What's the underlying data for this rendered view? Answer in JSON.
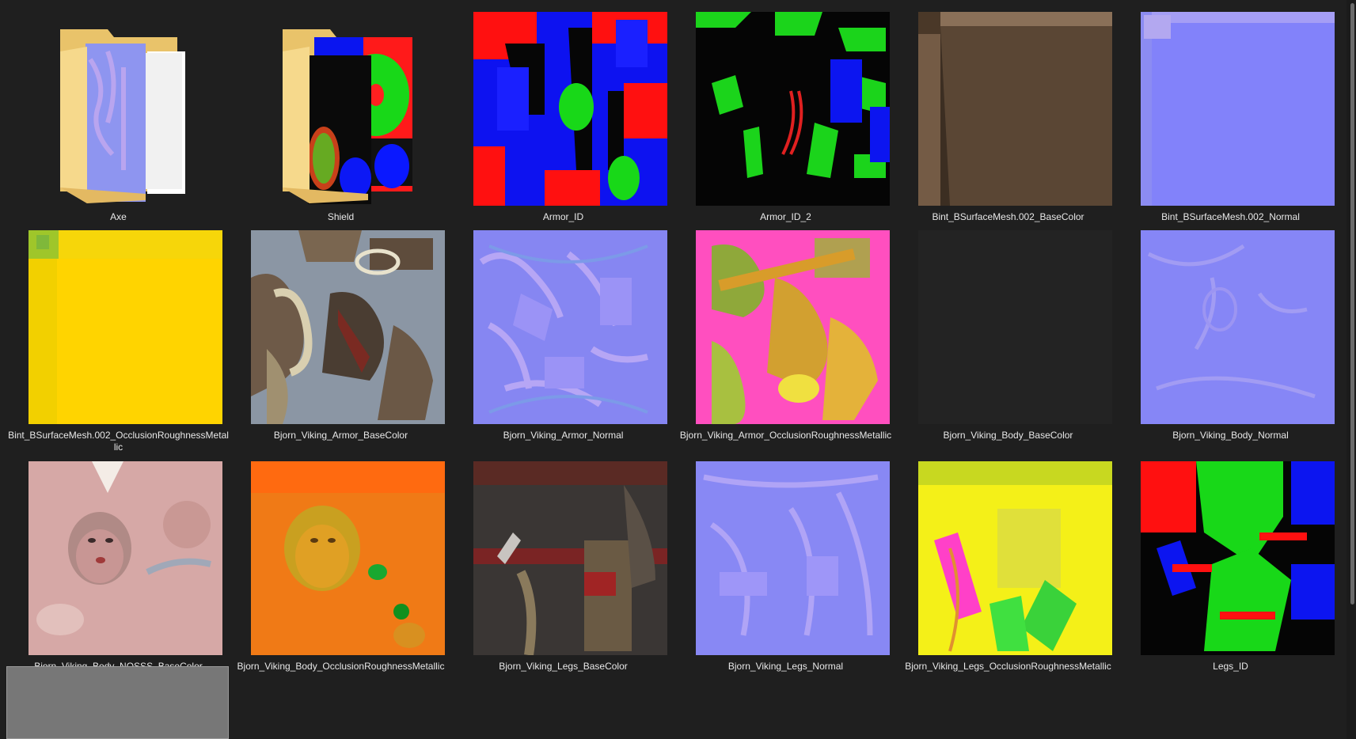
{
  "files": [
    {
      "name": "Axe",
      "kind": "folder-icon"
    },
    {
      "name": "Shield",
      "kind": "folder-icon"
    },
    {
      "name": "Armor_ID",
      "kind": "id-map-thumbnail"
    },
    {
      "name": "Armor_ID_2",
      "kind": "id-map-thumbnail"
    },
    {
      "name": "Bint_BSurfaceMesh.002_BaseColor",
      "kind": "basecolor-thumbnail"
    },
    {
      "name": "Bint_BSurfaceMesh.002_Normal",
      "kind": "normal-map-thumbnail"
    },
    {
      "name": "Bint_BSurfaceMesh.002_OcclusionRoughnessMetallic",
      "kind": "orm-map-thumbnail"
    },
    {
      "name": "Bjorn_Viking_Armor_BaseColor",
      "kind": "basecolor-thumbnail"
    },
    {
      "name": "Bjorn_Viking_Armor_Normal",
      "kind": "normal-map-thumbnail"
    },
    {
      "name": "Bjorn_Viking_Armor_OcclusionRoughnessMetallic",
      "kind": "orm-map-thumbnail"
    },
    {
      "name": "Bjorn_Viking_Body_BaseColor",
      "kind": "basecolor-thumbnail"
    },
    {
      "name": "Bjorn_Viking_Body_Normal",
      "kind": "normal-map-thumbnail"
    },
    {
      "name": "Bjorn_Viking_Body_NOSSS_BaseColor",
      "kind": "basecolor-thumbnail"
    },
    {
      "name": "Bjorn_Viking_Body_OcclusionRoughnessMetallic",
      "kind": "orm-map-thumbnail"
    },
    {
      "name": "Bjorn_Viking_Legs_BaseColor",
      "kind": "basecolor-thumbnail"
    },
    {
      "name": "Bjorn_Viking_Legs_Normal",
      "kind": "normal-map-thumbnail"
    },
    {
      "name": "Bjorn_Viking_Legs_OcclusionRoughnessMetallic",
      "kind": "orm-map-thumbnail"
    },
    {
      "name": "Legs_ID",
      "kind": "id-map-thumbnail"
    },
    {
      "name": "",
      "kind": "blank-thumbnail",
      "selected": true
    }
  ],
  "colors": {
    "background": "#1f1f1f",
    "caption_text": "#e8e8e8",
    "folder_yellow": "#f5d27a",
    "selection": "#777777"
  }
}
